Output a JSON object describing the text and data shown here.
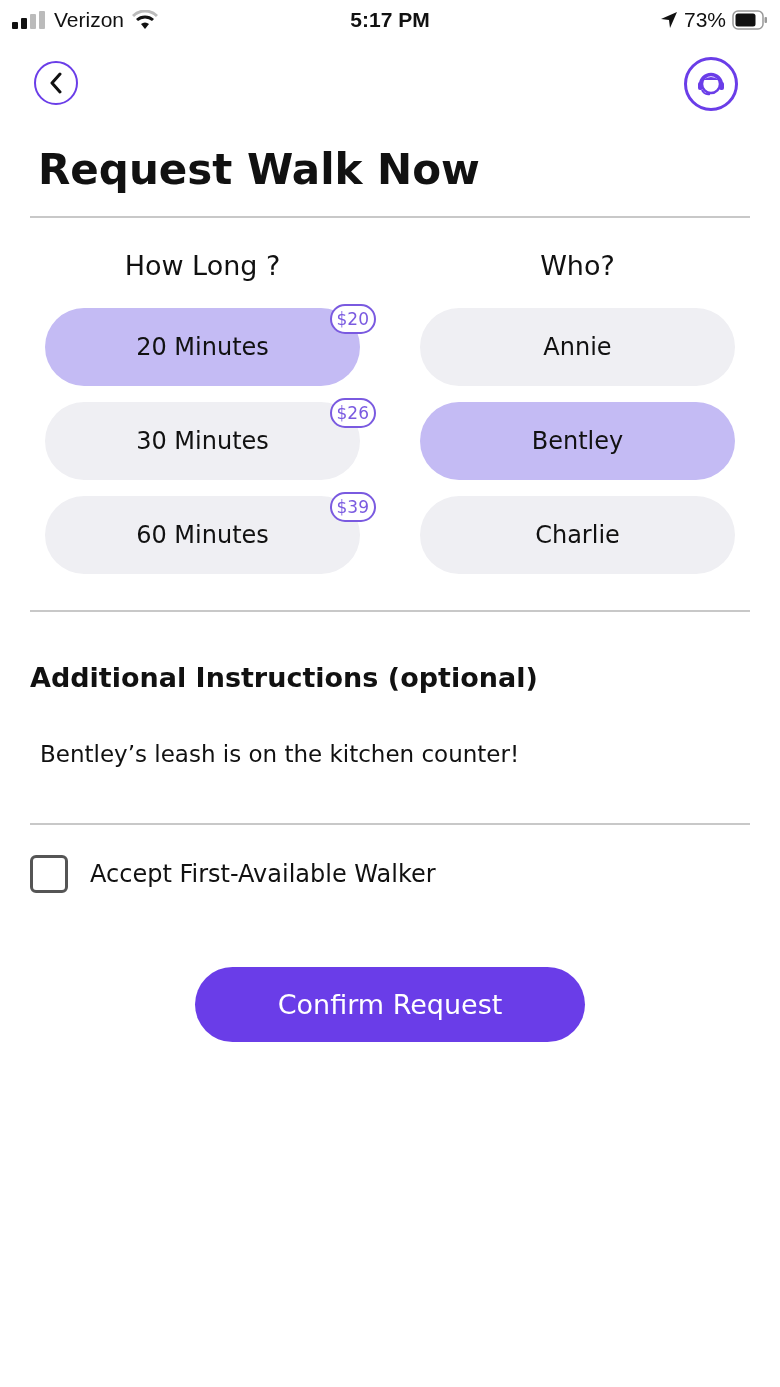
{
  "status_bar": {
    "carrier": "Verizon",
    "time": "5:17 PM",
    "battery": "73%"
  },
  "title": "Request Walk Now",
  "duration": {
    "heading": "How Long ?",
    "options": [
      {
        "label": "20 Minutes",
        "price": "$20",
        "selected": true
      },
      {
        "label": "30 Minutes",
        "price": "$26",
        "selected": false
      },
      {
        "label": "60 Minutes",
        "price": "$39",
        "selected": false
      }
    ]
  },
  "dogs": {
    "heading": "Who?",
    "options": [
      {
        "label": "Annie",
        "selected": false
      },
      {
        "label": "Bentley",
        "selected": true
      },
      {
        "label": "Charlie",
        "selected": false
      }
    ]
  },
  "instructions": {
    "heading": "Additional Instructions (optional)",
    "value": "Bentley’s leash is on the kitchen counter!"
  },
  "accept_first": {
    "label": "Accept First-Available Walker",
    "checked": false
  },
  "confirm_button": "Confirm Request"
}
